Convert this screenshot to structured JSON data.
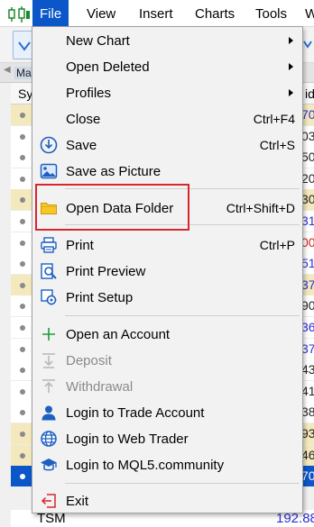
{
  "menubar": {
    "items": [
      "File",
      "View",
      "Insert",
      "Charts",
      "Tools",
      "W"
    ],
    "active": "File"
  },
  "market_watch": {
    "title": "Ma",
    "col_symbol": "Sy",
    "col_bid": "id",
    "rows": [
      {
        "value": "70",
        "color": "blue",
        "bg": "yellow"
      },
      {
        "value": "03",
        "color": "black",
        "bg": "white"
      },
      {
        "value": "50",
        "color": "black",
        "bg": "white"
      },
      {
        "value": "20",
        "color": "black",
        "bg": "white"
      },
      {
        "value": "30",
        "color": "black",
        "bg": "yellow"
      },
      {
        "value": "31",
        "color": "blue",
        "bg": "white"
      },
      {
        "value": "00",
        "color": "red",
        "bg": "white"
      },
      {
        "value": "51",
        "color": "blue",
        "bg": "white"
      },
      {
        "value": "37",
        "color": "blue",
        "bg": "yellow"
      },
      {
        "value": "90",
        "color": "black",
        "bg": "white"
      },
      {
        "value": "36",
        "color": "blue",
        "bg": "white"
      },
      {
        "value": "37",
        "color": "blue",
        "bg": "white"
      },
      {
        "value": "43",
        "color": "black",
        "bg": "white"
      },
      {
        "value": "41",
        "color": "black",
        "bg": "white"
      },
      {
        "value": "38",
        "color": "black",
        "bg": "white"
      },
      {
        "value": "93",
        "color": "black",
        "bg": "yellow"
      },
      {
        "value": "46",
        "color": "black",
        "bg": "yellow"
      },
      {
        "value": "70",
        "color": "blue",
        "bg": "selected"
      }
    ],
    "last_row": {
      "symbol": "TSM",
      "value": "192.88"
    }
  },
  "file_menu": {
    "new_chart": "New Chart",
    "open_deleted": "Open Deleted",
    "profiles": "Profiles",
    "close": {
      "label": "Close",
      "shortcut": "Ctrl+F4"
    },
    "save": {
      "label": "Save",
      "shortcut": "Ctrl+S"
    },
    "save_as_picture": "Save as Picture",
    "open_data_folder": {
      "label": "Open Data Folder",
      "shortcut": "Ctrl+Shift+D"
    },
    "print": {
      "label": "Print",
      "shortcut": "Ctrl+P"
    },
    "print_preview": "Print Preview",
    "print_setup": "Print Setup",
    "open_account": "Open an Account",
    "deposit": "Deposit",
    "withdrawal": "Withdrawal",
    "login_trade": "Login to Trade Account",
    "login_web": "Login to Web Trader",
    "login_mql5": "Login to MQL5.community",
    "exit": "Exit"
  },
  "colors": {
    "accent": "#0b57c9",
    "highlight_box": "#d8262e",
    "bid_blue": "#2d2fd6",
    "bid_red": "#d0201a",
    "row_yellow": "#f3e9bd"
  },
  "icons": {
    "app": "candlestick-icon",
    "save": "save-download-icon",
    "save_as_picture": "image-icon",
    "open_data_folder": "folder-icon",
    "print": "printer-icon",
    "print_preview": "print-preview-icon",
    "print_setup": "print-setup-gear-icon",
    "open_account": "plus-icon",
    "deposit": "deposit-icon",
    "withdrawal": "withdrawal-icon",
    "login_trade": "user-icon",
    "login_web": "globe-icon",
    "login_mql5": "graduation-cap-icon",
    "exit": "exit-icon"
  }
}
